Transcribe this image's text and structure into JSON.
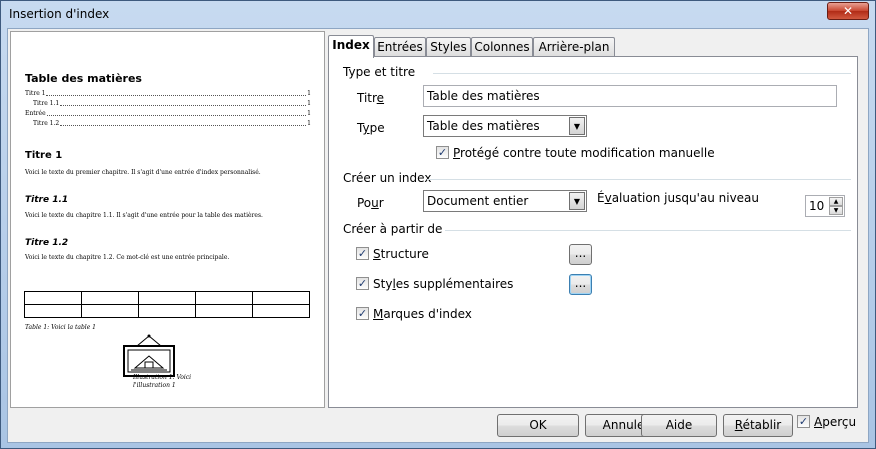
{
  "window": {
    "title": "Insertion d'index",
    "close_glyph": "✕"
  },
  "preview": {
    "toc_title": "Table des matières",
    "toc_entries": [
      {
        "text": "Titre 1",
        "page": "1"
      },
      {
        "text": "Titre 1.1",
        "page": "1"
      },
      {
        "text": "Entrée",
        "page": "1"
      },
      {
        "text": "Titre 1.2",
        "page": "1"
      }
    ],
    "h1": "Titre 1",
    "p1": "Voici le texte du premier chapitre. Il s'agit d'une entrée d'index personnalisé.",
    "h2a": "Titre 1.1",
    "p2": "Voici le texte du chapitre 1.1. Il s'agit d'une entrée pour la table des matières.",
    "h2b": "Titre 1.2",
    "p3": "Voici le texte du chapitre 1.2. Ce mot-clé est une entrée principale.",
    "table_caption": "Table 1: Voici la table 1",
    "illustration_caption_1": "Illustration 1: Voici",
    "illustration_caption_2": "l'illustration 1"
  },
  "tabs": [
    {
      "label": "Index",
      "active": true
    },
    {
      "label": "Entrées",
      "active": false
    },
    {
      "label": "Styles",
      "active": false
    },
    {
      "label": "Colonnes",
      "active": false
    },
    {
      "label": "Arrière-plan",
      "active": false
    }
  ],
  "type_titre": {
    "section": "Type et titre",
    "titre_label": "Titre",
    "titre_value": "Table des matières",
    "type_label": "Type",
    "type_value": "Table des matières",
    "protege_label": "Protégé contre toute modification manuelle",
    "protege_checked": true
  },
  "creer_index": {
    "section": "Créer un index",
    "pour_label": "Pour",
    "pour_value": "Document entier",
    "evaluation_label": "Évaluation jusqu'au niveau",
    "niveau_value": "10"
  },
  "creer_a_partir": {
    "section": "Créer à partir de",
    "structure_label": "Structure",
    "styles_label": "Styles supplémentaires",
    "marques_label": "Marques d'index",
    "browse_label": "..."
  },
  "buttons": {
    "ok": "OK",
    "annuler": "Annuler",
    "aide": "Aide",
    "retablir": "Rétablir",
    "apercu": "Aperçu"
  }
}
